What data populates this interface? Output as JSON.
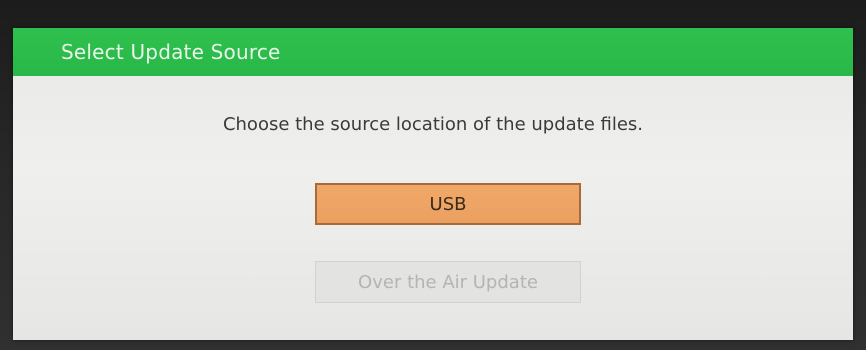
{
  "dialog": {
    "title": "Select Update Source",
    "message": "Choose the source location of the update files.",
    "options": [
      {
        "label": "USB",
        "state": "selected"
      },
      {
        "label": "Over the Air Update",
        "state": "disabled"
      }
    ]
  },
  "colors": {
    "title_bar": "#2fc04e",
    "selected_button": "#f0a868",
    "disabled_button": "#e3e3e1",
    "dialog_background": "#ececea"
  }
}
